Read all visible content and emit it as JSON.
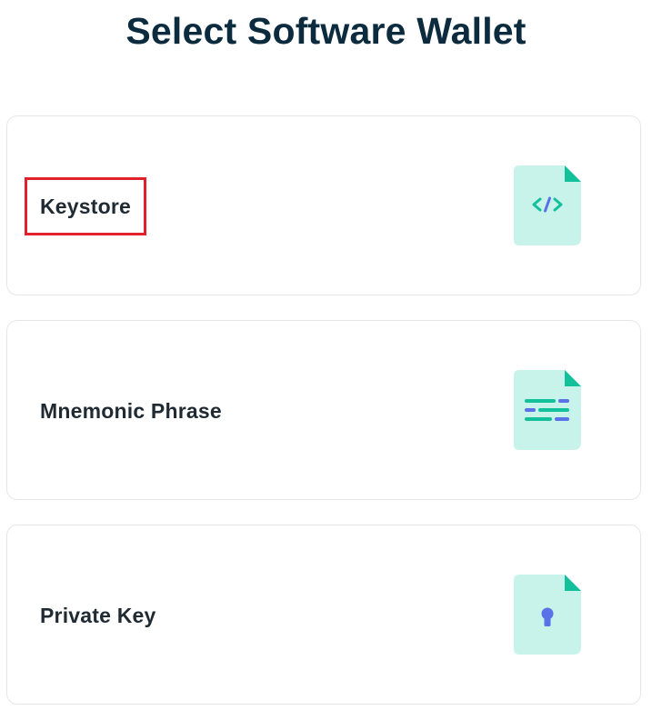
{
  "page": {
    "title": "Select Software Wallet"
  },
  "options": [
    {
      "label": "Keystore",
      "icon": "code-file-icon",
      "highlighted": true
    },
    {
      "label": "Mnemonic Phrase",
      "icon": "text-file-icon",
      "highlighted": false
    },
    {
      "label": "Private Key",
      "icon": "locked-file-icon",
      "highlighted": false
    }
  ],
  "colors": {
    "title": "#0d2b3e",
    "label": "#1f2a33",
    "card_border": "#e4e7ea",
    "icon_bg": "#c8f3ea",
    "icon_fold": "#12c19b",
    "icon_accent_green": "#12c19b",
    "icon_accent_blue": "#5a72e8",
    "highlight": "#e0202b"
  }
}
